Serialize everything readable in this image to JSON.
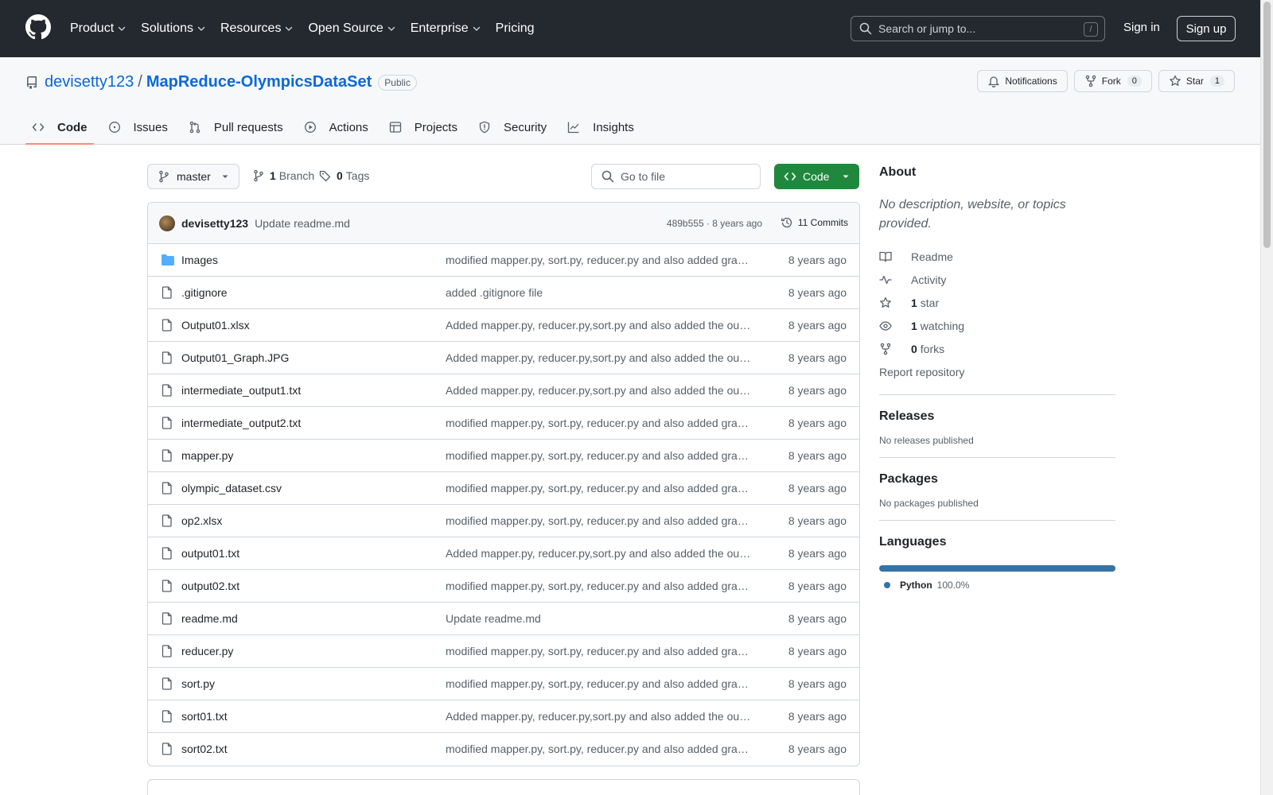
{
  "header": {
    "nav": [
      {
        "label": "Product",
        "dropdown": true
      },
      {
        "label": "Solutions",
        "dropdown": true
      },
      {
        "label": "Resources",
        "dropdown": true
      },
      {
        "label": "Open Source",
        "dropdown": true
      },
      {
        "label": "Enterprise",
        "dropdown": true
      },
      {
        "label": "Pricing",
        "dropdown": false
      }
    ],
    "search_placeholder": "Search or jump to...",
    "search_shortcut": "/",
    "signin": "Sign in",
    "signup": "Sign up"
  },
  "repo": {
    "owner": "devisetty123",
    "separator": "/",
    "name": "MapReduce-OlympicsDataSet",
    "visibility": "Public",
    "notifications": "Notifications",
    "fork_label": "Fork",
    "fork_count": "0",
    "star_label": "Star",
    "star_count": "1"
  },
  "tabs": [
    {
      "label": "Code",
      "icon": "code-icon",
      "active": true
    },
    {
      "label": "Issues",
      "icon": "issue-icon",
      "active": false
    },
    {
      "label": "Pull requests",
      "icon": "pull-request-icon",
      "active": false
    },
    {
      "label": "Actions",
      "icon": "play-icon",
      "active": false
    },
    {
      "label": "Projects",
      "icon": "table-icon",
      "active": false
    },
    {
      "label": "Security",
      "icon": "shield-icon",
      "active": false
    },
    {
      "label": "Insights",
      "icon": "graph-icon",
      "active": false
    }
  ],
  "toolbar": {
    "branch": "master",
    "branch_count": "1",
    "branch_label": "Branch",
    "tag_count": "0",
    "tag_label": "Tags",
    "goto_placeholder": "Go to file",
    "code_button": "Code"
  },
  "commit": {
    "author": "devisetty123",
    "message": "Update readme.md",
    "meta": "489b555 · 8 years ago",
    "commits": "11 Commits"
  },
  "files": [
    {
      "name": "Images",
      "type": "folder",
      "message": "modified mapper.py, sort.py, reducer.py and also added graphs",
      "time": "8 years ago"
    },
    {
      "name": ".gitignore",
      "type": "file",
      "message": "added .gitignore file",
      "time": "8 years ago"
    },
    {
      "name": "Output01.xlsx",
      "type": "file",
      "message": "Added mapper.py, reducer.py,sort.py and also added the output files",
      "time": "8 years ago"
    },
    {
      "name": "Output01_Graph.JPG",
      "type": "file",
      "message": "Added mapper.py, reducer.py,sort.py and also added the output files",
      "time": "8 years ago"
    },
    {
      "name": "intermediate_output1.txt",
      "type": "file",
      "message": "Added mapper.py, reducer.py,sort.py and also added the output files",
      "time": "8 years ago"
    },
    {
      "name": "intermediate_output2.txt",
      "type": "file",
      "message": "modified mapper.py, sort.py, reducer.py and also added graphs",
      "time": "8 years ago"
    },
    {
      "name": "mapper.py",
      "type": "file",
      "message": "modified mapper.py, sort.py, reducer.py and also added graphs",
      "time": "8 years ago"
    },
    {
      "name": "olympic_dataset.csv",
      "type": "file",
      "message": "modified mapper.py, sort.py, reducer.py and also added graphs",
      "time": "8 years ago"
    },
    {
      "name": "op2.xlsx",
      "type": "file",
      "message": "modified mapper.py, sort.py, reducer.py and also added graphs",
      "time": "8 years ago"
    },
    {
      "name": "output01.txt",
      "type": "file",
      "message": "Added mapper.py, reducer.py,sort.py and also added the output files",
      "time": "8 years ago"
    },
    {
      "name": "output02.txt",
      "type": "file",
      "message": "modified mapper.py, sort.py, reducer.py and also added graphs",
      "time": "8 years ago"
    },
    {
      "name": "readme.md",
      "type": "file",
      "message": "Update readme.md",
      "time": "8 years ago"
    },
    {
      "name": "reducer.py",
      "type": "file",
      "message": "modified mapper.py, sort.py, reducer.py and also added graphs",
      "time": "8 years ago"
    },
    {
      "name": "sort.py",
      "type": "file",
      "message": "modified mapper.py, sort.py, reducer.py and also added graphs",
      "time": "8 years ago"
    },
    {
      "name": "sort01.txt",
      "type": "file",
      "message": "Added mapper.py, reducer.py,sort.py and also added the output files",
      "time": "8 years ago"
    },
    {
      "name": "sort02.txt",
      "type": "file",
      "message": "modified mapper.py, sort.py, reducer.py and also added graphs",
      "time": "8 years ago"
    }
  ],
  "sidebar": {
    "about_title": "About",
    "about_desc": "No description, website, or topics provided.",
    "links": [
      {
        "icon": "book-icon",
        "count": "",
        "label": "Readme"
      },
      {
        "icon": "pulse-icon",
        "count": "",
        "label": "Activity"
      },
      {
        "icon": "star-icon",
        "count": "1",
        "label": "star"
      },
      {
        "icon": "eye-icon",
        "count": "1",
        "label": "watching"
      },
      {
        "icon": "fork-icon",
        "count": "0",
        "label": "forks"
      }
    ],
    "report": "Report repository",
    "releases_title": "Releases",
    "releases_text": "No releases published",
    "packages_title": "Packages",
    "packages_text": "No packages published",
    "languages_title": "Languages",
    "languages": [
      {
        "name": "Python",
        "percent": "100.0%",
        "fraction": 1.0,
        "color": "#3572A5"
      }
    ]
  },
  "colors": {
    "header_bg": "#24292f",
    "link": "#0969da",
    "code_button": "#1f883d",
    "active_tab_underline": "#fd8c73",
    "folder": "#54aeff"
  }
}
